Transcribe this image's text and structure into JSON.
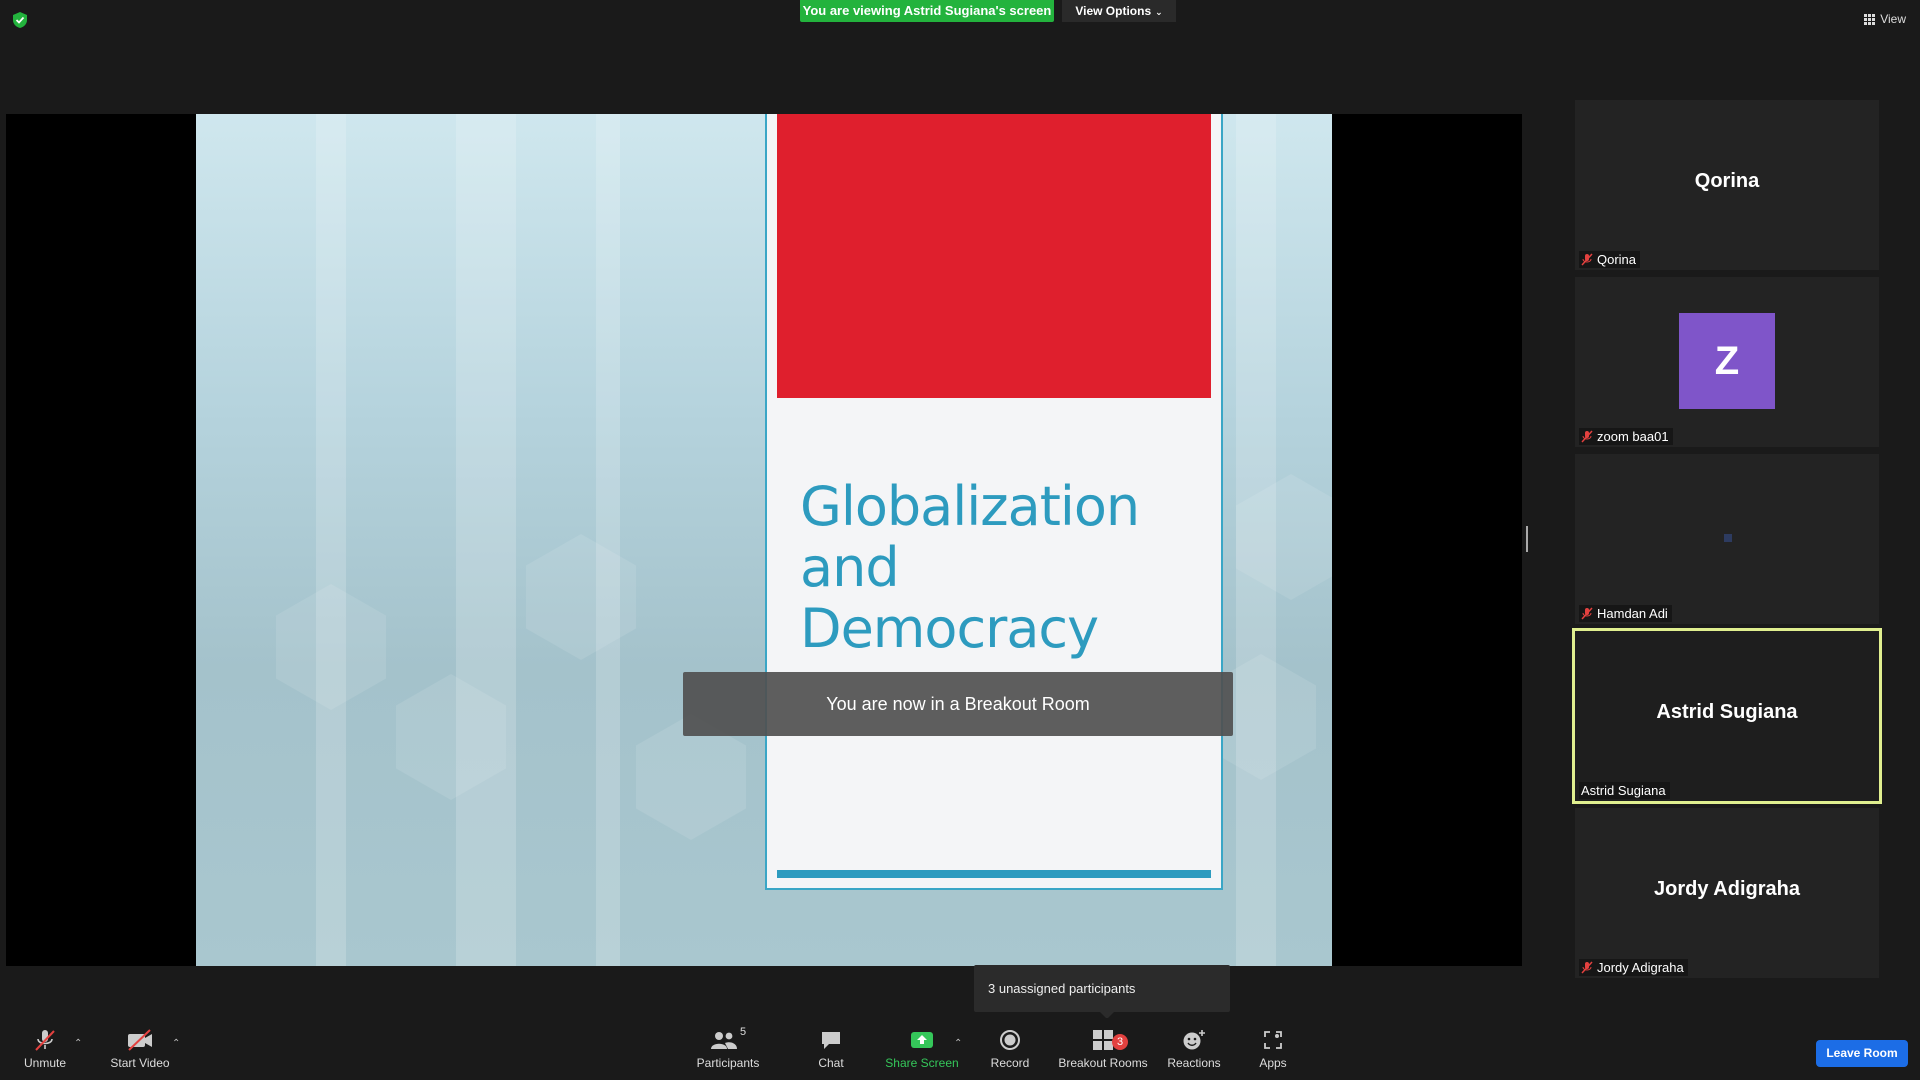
{
  "top": {
    "viewing_banner": "You are viewing Astrid Sugiana's screen",
    "view_options_label": "View Options",
    "view_label": "View"
  },
  "slide": {
    "title_lines": [
      "Globalization",
      "and",
      "Democracy"
    ],
    "toast": "You are now in a Breakout Room"
  },
  "gallery": {
    "tiles": [
      {
        "big_name": "Qorina",
        "label": "Qorina",
        "muted": true
      },
      {
        "avatar_letter": "Z",
        "label": "zoom baa01",
        "muted": true
      },
      {
        "label": "Hamdan Adi",
        "muted": true
      },
      {
        "big_name": "Astrid Sugiana",
        "label": "Astrid Sugiana",
        "muted": false,
        "active": true
      },
      {
        "big_name": "Jordy Adigraha",
        "label": "Jordy Adigraha",
        "muted": true
      }
    ]
  },
  "tooltip": {
    "unassigned": "3 unassigned participants"
  },
  "toolbar": {
    "unmute": "Unmute",
    "start_video": "Start Video",
    "participants": "Participants",
    "participants_count": "5",
    "chat": "Chat",
    "share_screen": "Share Screen",
    "record": "Record",
    "breakout_rooms": "Breakout Rooms",
    "breakout_badge": "3",
    "reactions": "Reactions",
    "apps": "Apps",
    "leave_room": "Leave Room"
  },
  "colors": {
    "banner_green": "#23b33d",
    "share_green": "#35c75a",
    "leave_blue": "#1c6de6",
    "slide_red": "#df1f2d",
    "slide_teal": "#2d9bbf",
    "active_speaker": "#e0ef8f",
    "avatar_purple": "#7f55c9"
  }
}
